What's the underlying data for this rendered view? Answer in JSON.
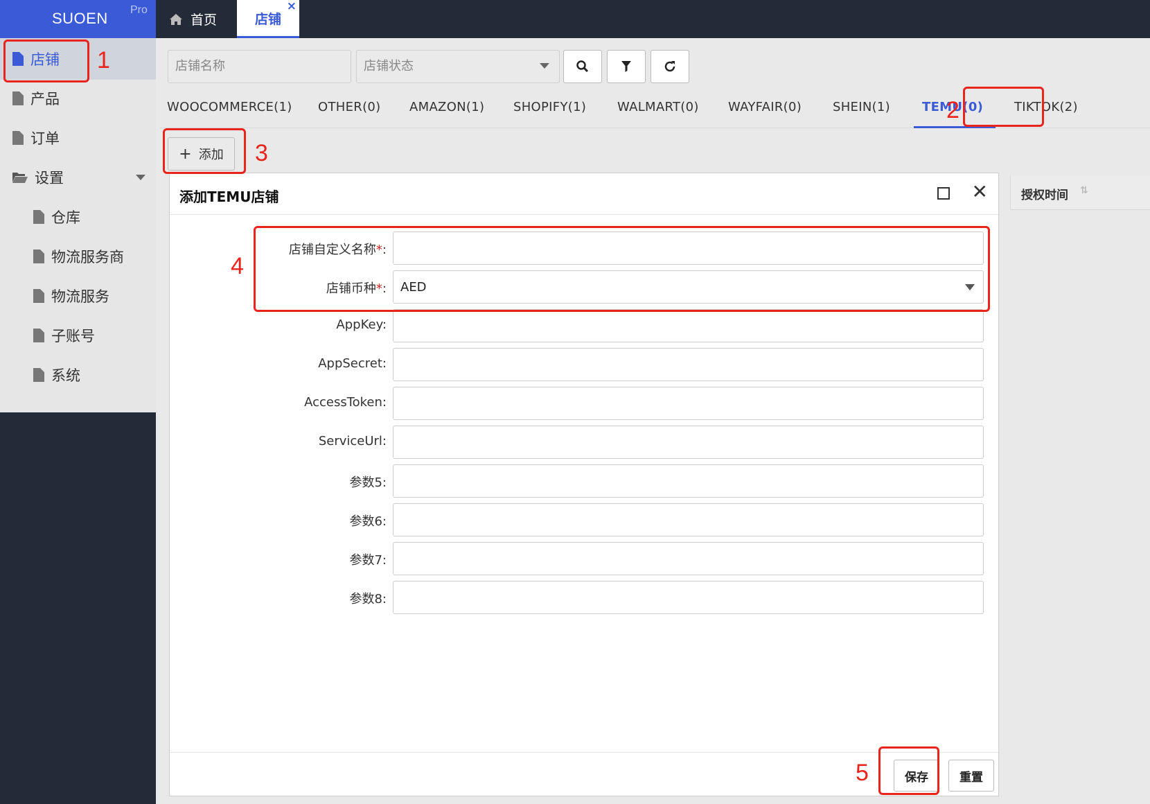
{
  "app": {
    "brand": "SUOEN",
    "edition": "Pro"
  },
  "topbar": {
    "tabs": [
      {
        "label": "首页",
        "icon": "home-icon"
      },
      {
        "label": "店铺",
        "close": "×"
      }
    ]
  },
  "sidebar": {
    "items": [
      {
        "label": "店铺",
        "icon": "file-icon"
      },
      {
        "label": "产品",
        "icon": "file-icon"
      },
      {
        "label": "订单",
        "icon": "file-icon"
      },
      {
        "label": "设置",
        "icon": "folder-open-icon"
      },
      {
        "label": "仓库",
        "icon": "file-icon"
      },
      {
        "label": "物流服务商",
        "icon": "file-icon"
      },
      {
        "label": "物流服务",
        "icon": "file-icon"
      },
      {
        "label": "子账号",
        "icon": "file-icon"
      },
      {
        "label": "系统",
        "icon": "file-icon"
      }
    ]
  },
  "search": {
    "name_placeholder": "店铺名称",
    "status_placeholder": "店铺状态"
  },
  "platform_tabs": [
    {
      "label": "WOOCOMMERCE(1)"
    },
    {
      "label": "OTHER(0)"
    },
    {
      "label": "AMAZON(1)"
    },
    {
      "label": "SHOPIFY(1)"
    },
    {
      "label": "WALMART(0)"
    },
    {
      "label": "WAYFAIR(0)"
    },
    {
      "label": "SHEIN(1)"
    },
    {
      "label": "TEMU(0)"
    },
    {
      "label": "TIKTOK(2)"
    }
  ],
  "add_button": {
    "plus": "+",
    "label": "添加"
  },
  "table": {
    "column": "授权时间",
    "sort": "⇅"
  },
  "dialog": {
    "title": "添加TEMU店铺",
    "fields": [
      {
        "label": "店铺自定义名称",
        "required_mark": "*",
        "colon": ":",
        "value": ""
      },
      {
        "label": "店铺币种",
        "required_mark": "*",
        "colon": ":",
        "value": "AED"
      },
      {
        "label": "AppKey",
        "colon": ":",
        "value": ""
      },
      {
        "label": "AppSecret",
        "colon": ":",
        "value": ""
      },
      {
        "label": "AccessToken",
        "colon": ":",
        "value": ""
      },
      {
        "label": "ServiceUrl",
        "colon": ":",
        "value": ""
      },
      {
        "label": "参数5",
        "colon": ":",
        "value": ""
      },
      {
        "label": "参数6",
        "colon": ":",
        "value": ""
      },
      {
        "label": "参数7",
        "colon": ":",
        "value": ""
      },
      {
        "label": "参数8",
        "colon": ":",
        "value": ""
      }
    ],
    "save_label": "保存",
    "reset_label": "重置"
  },
  "annotations": [
    "1",
    "2",
    "3",
    "4",
    "5"
  ],
  "colors": {
    "accent": "#3b5bd6",
    "sidebar_dark": "#232a38",
    "annotation_red": "#e8241c"
  }
}
